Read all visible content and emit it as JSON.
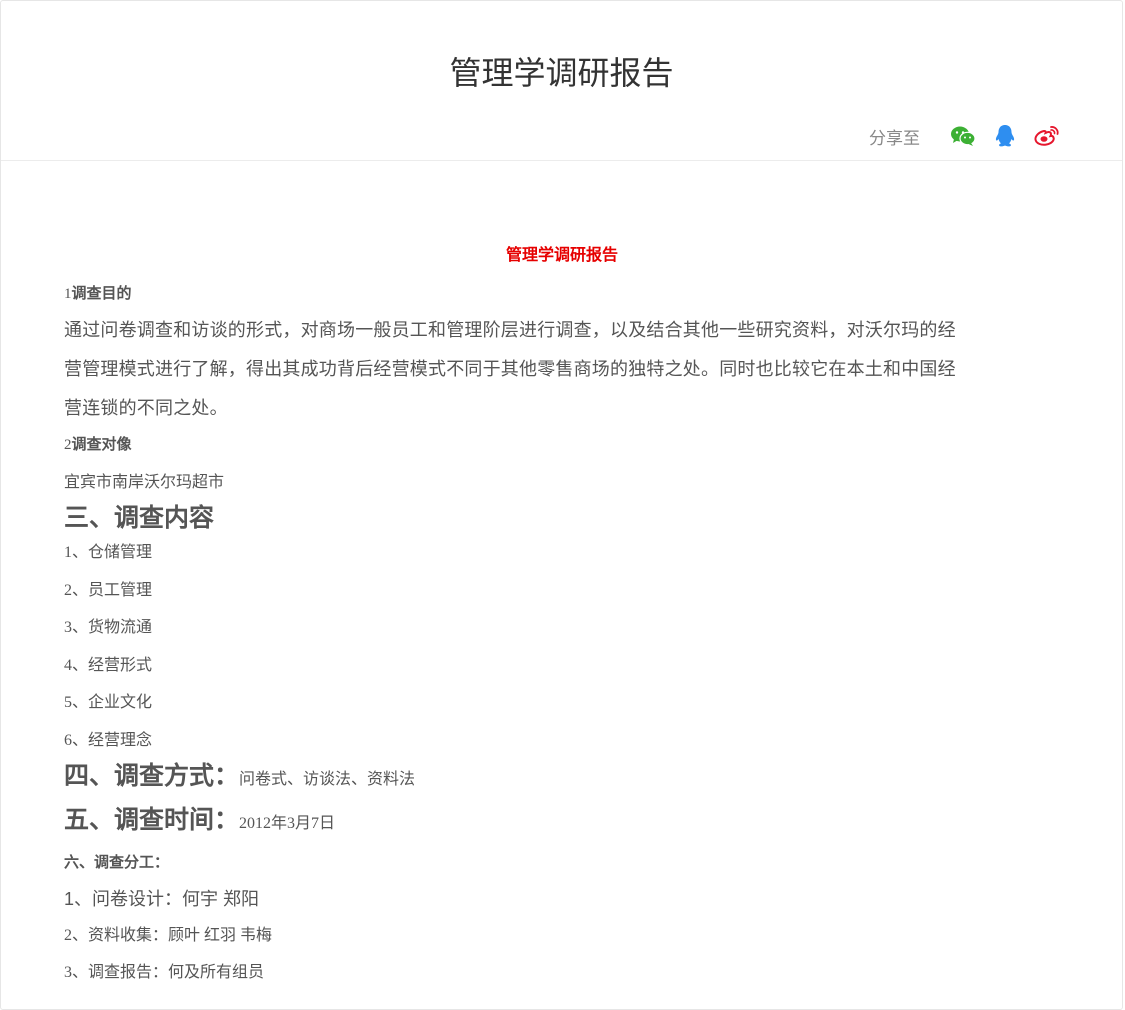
{
  "header": {
    "title": "管理学调研报告",
    "share_label": "分享至",
    "share_icons": [
      {
        "name": "wechat-icon",
        "color": "#3cb034"
      },
      {
        "name": "qq-icon",
        "color": "#2e8ef0"
      },
      {
        "name": "weibo-icon",
        "color": "#e6162d"
      }
    ]
  },
  "doc": {
    "heading": "管理学调研报告",
    "heading_color": "#e60000",
    "s1_num": "1",
    "s1_title": "调查目的",
    "s1_body_line1": "通过问卷调查和访谈的形式，对商场一般员工和管理阶层进行调查，以及结合其他一些研究资料，对沃尔玛的经",
    "s1_body_line2": "营管理模式进行了解，得出其成功背后经营模式不同于其他零售商场的独特之处。同时也比较它在本土和中国经",
    "s1_body_line3": "营连锁的不同之处。",
    "s2_num": "2",
    "s2_title": "调查对像",
    "s2_body": "宜宾市南岸沃尔玛超市",
    "s3_title": "三、调查内容",
    "s3_items": [
      "1、仓储管理",
      "2、员工管理",
      "3、货物流通",
      "4、经营形式",
      "5、企业文化",
      "6、经营理念"
    ],
    "s4_title": "四、调查方式：",
    "s4_value": "问卷式、访谈法、资料法",
    "s5_title": "五、调查时间：",
    "s5_value": "2012年3月7日",
    "s6_title": "六、调查分工：",
    "s6_item1": "1、问卷设计：何宇 郑阳",
    "s6_item2": "2、资料收集：顾叶 红羽 韦梅",
    "s6_item3": "3、调查报告：何及所有组员"
  }
}
